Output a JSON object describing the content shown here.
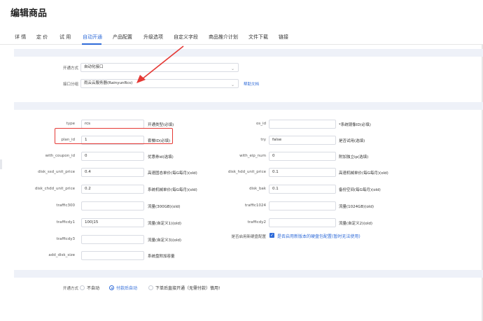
{
  "page": {
    "title": "编辑商品"
  },
  "tabs": [
    {
      "label": "详 情"
    },
    {
      "label": "定 价"
    },
    {
      "label": "试 用"
    },
    {
      "label": "自动开通",
      "active": true
    },
    {
      "label": "产品配置"
    },
    {
      "label": "升级选项"
    },
    {
      "label": "自定义字段"
    },
    {
      "label": "商品推介计划"
    },
    {
      "label": "文件下载"
    },
    {
      "label": "链接"
    }
  ],
  "section1": {
    "open_method": {
      "label": "开通方式",
      "value": "自动化接口"
    },
    "interface_group": {
      "label": "接口分组",
      "value": "雨云云服务器(RainyunRcs)",
      "help_link": "帮助文档"
    }
  },
  "fields_left": [
    {
      "label": "type",
      "value": "rcs",
      "hint": "开通类型(必填)"
    },
    {
      "label": "plan_id",
      "value": "1",
      "hint": "套餐ID(必填)"
    },
    {
      "label": "with_coupon_id",
      "value": "0",
      "hint": "优惠券id(选填)"
    },
    {
      "label": "disk_ssd_unit_price",
      "value": "0.4",
      "hint": "高速固态单价(每G每月)(old)"
    },
    {
      "label": "disk_chdd_unit_price",
      "value": "0.2",
      "hint": "系统机械单价(每G每月)(old)"
    },
    {
      "label": "traffic300",
      "value": "",
      "hint": "流量(300GB)(old)"
    },
    {
      "label": "trafficdy1",
      "value": "100|15",
      "hint": "流量(自定义1)(old)"
    },
    {
      "label": "trafficdy3",
      "value": "",
      "hint": "流量(自定义3)(old)"
    },
    {
      "label": "add_disk_size",
      "value": "",
      "hint": "系统盘附加容量"
    }
  ],
  "fields_right": [
    {
      "label": "os_id",
      "value": "",
      "hint": "*系统镜像ID(必填)"
    },
    {
      "label": "try",
      "value": "false",
      "hint": "是否试用(选填)"
    },
    {
      "label": "with_eip_num",
      "value": "0",
      "hint": "附加独立ip(选填)"
    },
    {
      "label": "disk_hdd_unit_price",
      "value": "0.1",
      "hint": "高速机械单价(每G每月)(old)"
    },
    {
      "label": "disk_bak",
      "value": "0.1",
      "hint": "备份空间(每G每月)(old)"
    },
    {
      "label": "traffic1024",
      "value": "",
      "hint": "流量(1024GB)(old)"
    },
    {
      "label": "trafficdy2",
      "value": "",
      "hint": "流量(自定义2)(old)"
    }
  ],
  "new_disk": {
    "label": "是否启用新硬盘配置",
    "checkbox_label": "是否启用新版本的硬盘包配置(暂时无法使用)",
    "checked": true
  },
  "open_mode": {
    "label": "开通方式",
    "options": [
      {
        "label": "不自动",
        "selected": false
      },
      {
        "label": "付款后自动",
        "selected": true
      },
      {
        "label": "下单后直接开通（无需付款）慎用!",
        "selected": false
      }
    ]
  },
  "colors": {
    "accent": "#2f6bd8",
    "annotation": "#e53935",
    "band": "#eef1f8"
  }
}
